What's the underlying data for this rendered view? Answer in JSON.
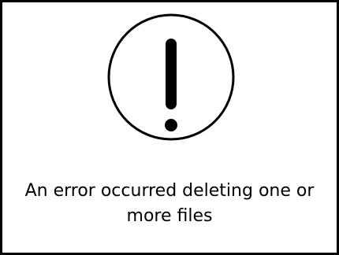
{
  "dialog": {
    "icon": "exclamation-circle-icon",
    "message": "An error occurred deleting one or more files"
  },
  "colors": {
    "foreground": "#000000",
    "background": "#ffffff"
  }
}
